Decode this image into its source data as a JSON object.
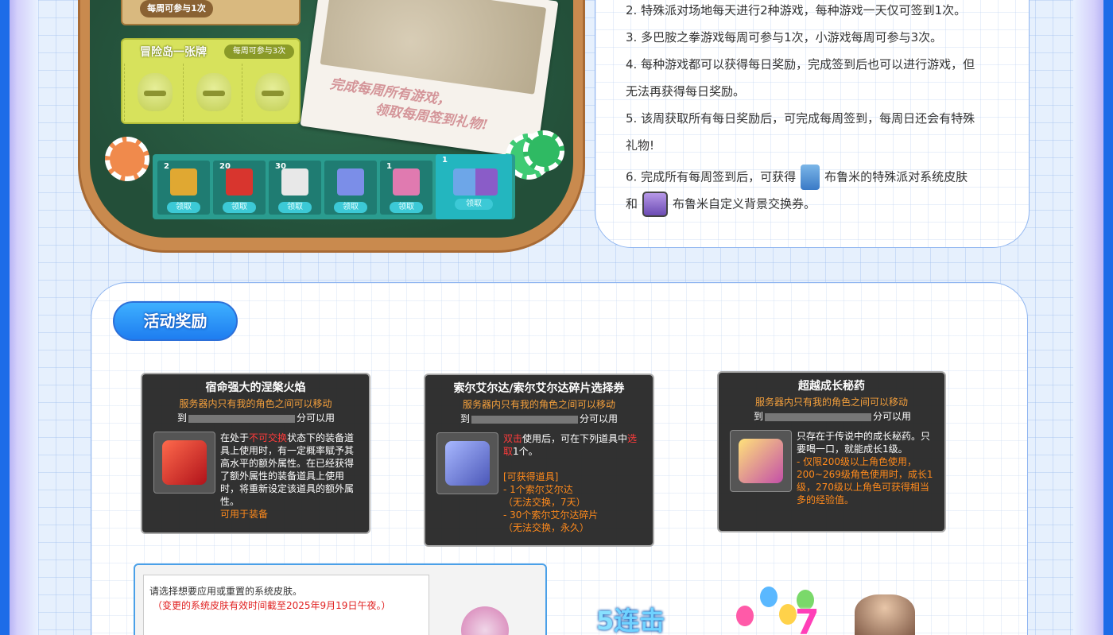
{
  "board": {
    "weekly_pill": "每周可参与1次",
    "card_panel": {
      "title": "冒险岛一张牌",
      "pill": "每周可参与3次"
    },
    "photo_caption_line1": "完成每周所有游戏，",
    "photo_caption_line2": "领取每周签到礼物!",
    "rewards": [
      {
        "count": "2",
        "button": "领取",
        "color": "#e0a832"
      },
      {
        "count": "20",
        "button": "领取",
        "color": "#d8352e"
      },
      {
        "count": "30",
        "button": "领取",
        "color": "#e8e8e8"
      },
      {
        "count": "",
        "button": "领取",
        "color": "#7b8ee8"
      },
      {
        "count": "1",
        "button": "领取",
        "color": "#e07ab0"
      },
      {
        "count": "1",
        "button": "领取",
        "color": "#6da6e8"
      }
    ]
  },
  "rules": {
    "line1": "2. 特殊派对场地每天进行2种游戏，每种游戏一天仅可签到1次。",
    "line2": "3. 多巴胺之拳游戏每周可参与1次，小游戏每周可参与3次。",
    "line3": "4. 每种游戏都可以获得每日奖励，完成签到后也可以进行游戏，但",
    "line4": "无法再获得每日奖励。",
    "line5": "5. 该周获取所有每日奖励后，可完成每周签到，每周日还会有特殊",
    "line6": "礼物!",
    "line7_a": "6. 完成所有每周签到后，可获得",
    "line7_b": "布鲁米的特殊派对系统皮肤",
    "line8_a": "和",
    "line8_b": "布鲁米自定义背景交换券。"
  },
  "activity": {
    "title": "活动奖励",
    "items": [
      {
        "name": "宿命强大的涅槃火焰",
        "sub": "服务器内只有我的角色之间可以移动",
        "to": "到",
        "to_suffix": "分可以用",
        "desc_a": "在处于",
        "desc_hl": "不可交换",
        "desc_b": "状态下的装备道具上使用时，有一定概率赋予其高水平的额外属性。在已经获得了额外属性的装备道具上使用时，将重新设定该道具的额外属性。",
        "usage": "可用于装备",
        "gem_color": "#d8352e"
      },
      {
        "name": "索尔艾尔达/索尔艾尔达碎片选择券",
        "sub": "服务器内只有我的角色之间可以移动",
        "to": "到",
        "to_suffix": "分可以用",
        "desc_hl1": "双击",
        "desc_a": "使用后，可在下列道具中",
        "desc_hl2": "选取",
        "desc_b": "1个。",
        "avail_title": "[可获得道具]",
        "avail_1": "- 1个索尔艾尔达",
        "avail_1b": "（无法交换，7天）",
        "avail_2": "- 30个索尔艾尔达碎片",
        "avail_2b": "（无法交换，永久）",
        "gem_color": "#7b8ee8"
      },
      {
        "name": "超越成长秘药",
        "sub": "服务器内只有我的角色之间可以移动",
        "to": "到",
        "to_suffix": "分可以用",
        "desc_a": "只存在于传说中的成长秘药。只要喝一口，就能成长1级。",
        "desc_hl": "- 仅限200级以上角色使用，200~269级角色使用时，成长1级，270级以上角色可获得相当多的经验值。",
        "gem_color": "#e8b43a"
      }
    ],
    "skin_window": {
      "line1": "请选择想要应用或重置的系统皮肤。",
      "line2": "（变更的系统皮肤有效时间截至2025年9月19日午夜。）"
    },
    "combo_number": "5",
    "combo_text": "连击",
    "party_number": "7"
  }
}
